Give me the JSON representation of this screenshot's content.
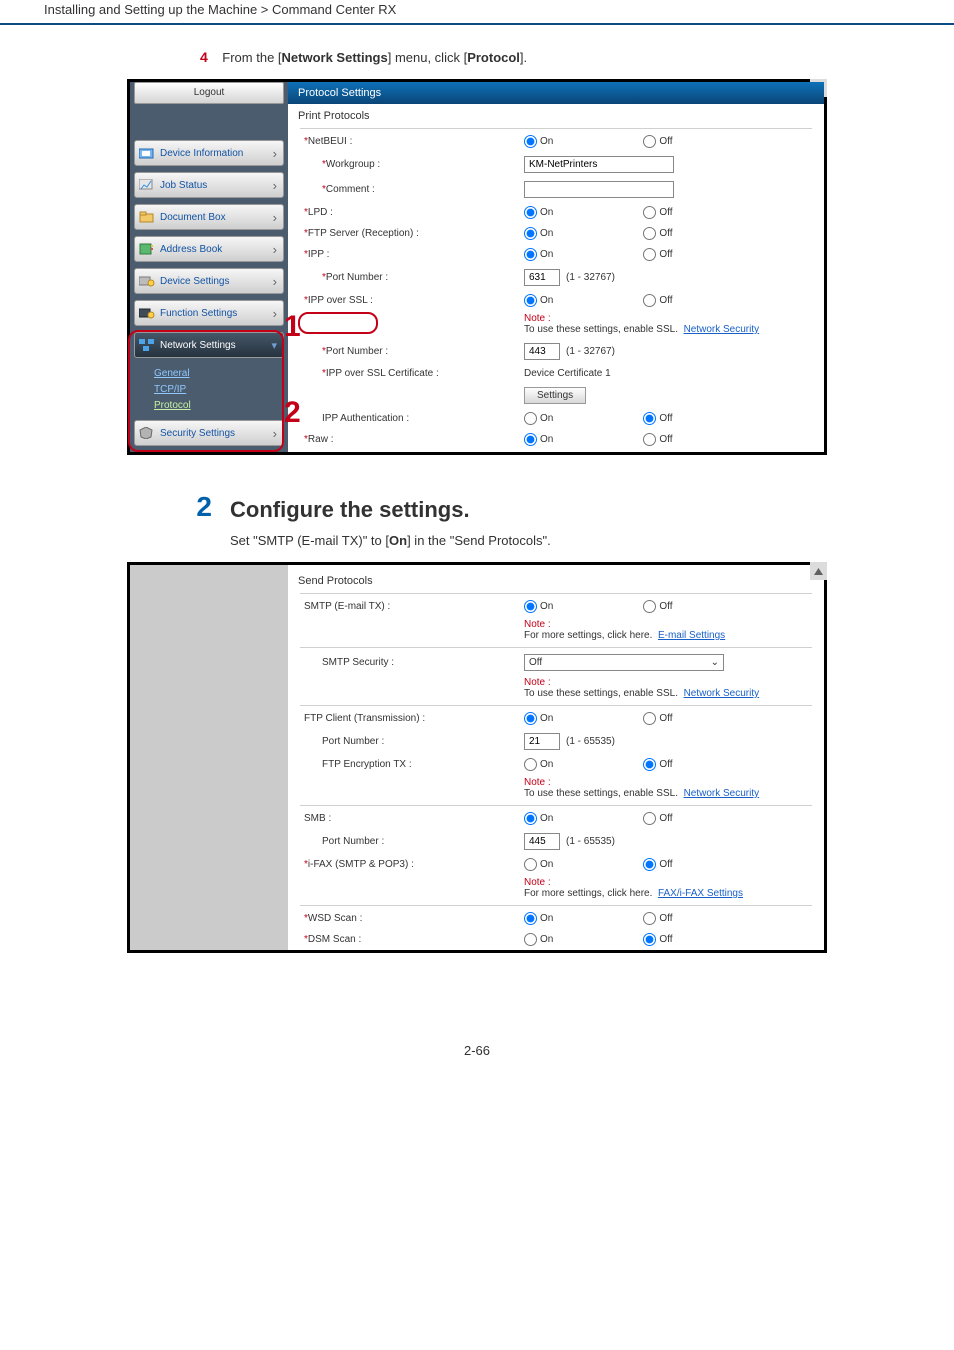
{
  "header": "Installing and Setting up the Machine > Command Center RX",
  "step4": {
    "num": "4",
    "pre": "From the [",
    "bold1": "Network Settings",
    "mid": "] menu, click [",
    "bold2": "Protocol",
    "post": "]."
  },
  "markers": {
    "one": "1",
    "two": "2"
  },
  "sidebar": {
    "logout": "Logout",
    "items": [
      "Device Information",
      "Job Status",
      "Document Box",
      "Address Book",
      "Device Settings",
      "Function Settings",
      "Network Settings",
      "Security Settings"
    ],
    "sub": {
      "general": "General",
      "tcpip": "TCP/IP",
      "protocol": "Protocol"
    }
  },
  "panel1": {
    "header": "Protocol Settings",
    "section": "Print Protocols",
    "rows": {
      "netbeui": "NetBEUI :",
      "workgroup": "Workgroup :",
      "workgroup_val": "KM-NetPrinters",
      "comment": "Comment :",
      "lpd": "LPD :",
      "ftp": "FTP Server (Reception) :",
      "ipp": "IPP :",
      "portnum": "Port Number :",
      "port631": "631",
      "range1": "(1 - 32767)",
      "ippssl": "IPP over SSL :",
      "port443": "443",
      "ippcert": "IPP over SSL Certificate :",
      "devcert": "Device Certificate 1",
      "settings_btn": "Settings",
      "ippauth": "IPP Authentication :",
      "raw": "Raw :"
    },
    "note": {
      "note_lbl": "Note :",
      "txt": "To use these settings, enable SSL.",
      "link": "Network Security"
    },
    "opts": {
      "on": "On",
      "off": "Off",
      "star": "*"
    }
  },
  "step2": {
    "num": "2",
    "heading": "Configure the settings.",
    "body_pre": "Set \"SMTP (E-mail TX)\" to [",
    "body_bold": "On",
    "body_post": "] in the \"Send Protocols\"."
  },
  "panel2": {
    "section": "Send Protocols",
    "rows": {
      "smtp": "SMTP (E-mail TX) :",
      "smtpsec": "SMTP Security :",
      "smtpsec_val": "Off",
      "ftpc": "FTP Client (Transmission) :",
      "portnum": "Port Number :",
      "p21": "21",
      "r65535": "(1 - 65535)",
      "ftpenc": "FTP Encryption TX :",
      "smb": "SMB :",
      "p445": "445",
      "ifax": "i-FAX (SMTP & POP3) :",
      "wsd": "WSD Scan :",
      "dsm": "DSM Scan :"
    },
    "notes": {
      "note_lbl": "Note :",
      "more": "For more settings, click here.",
      "email": "E-mail Settings",
      "enable": "To use these settings, enable SSL.",
      "netsec": "Network Security",
      "faxifax": "FAX/i-FAX Settings"
    },
    "opts": {
      "on": "On",
      "off": "Off",
      "star": "*"
    }
  },
  "pagenum": "2-66"
}
